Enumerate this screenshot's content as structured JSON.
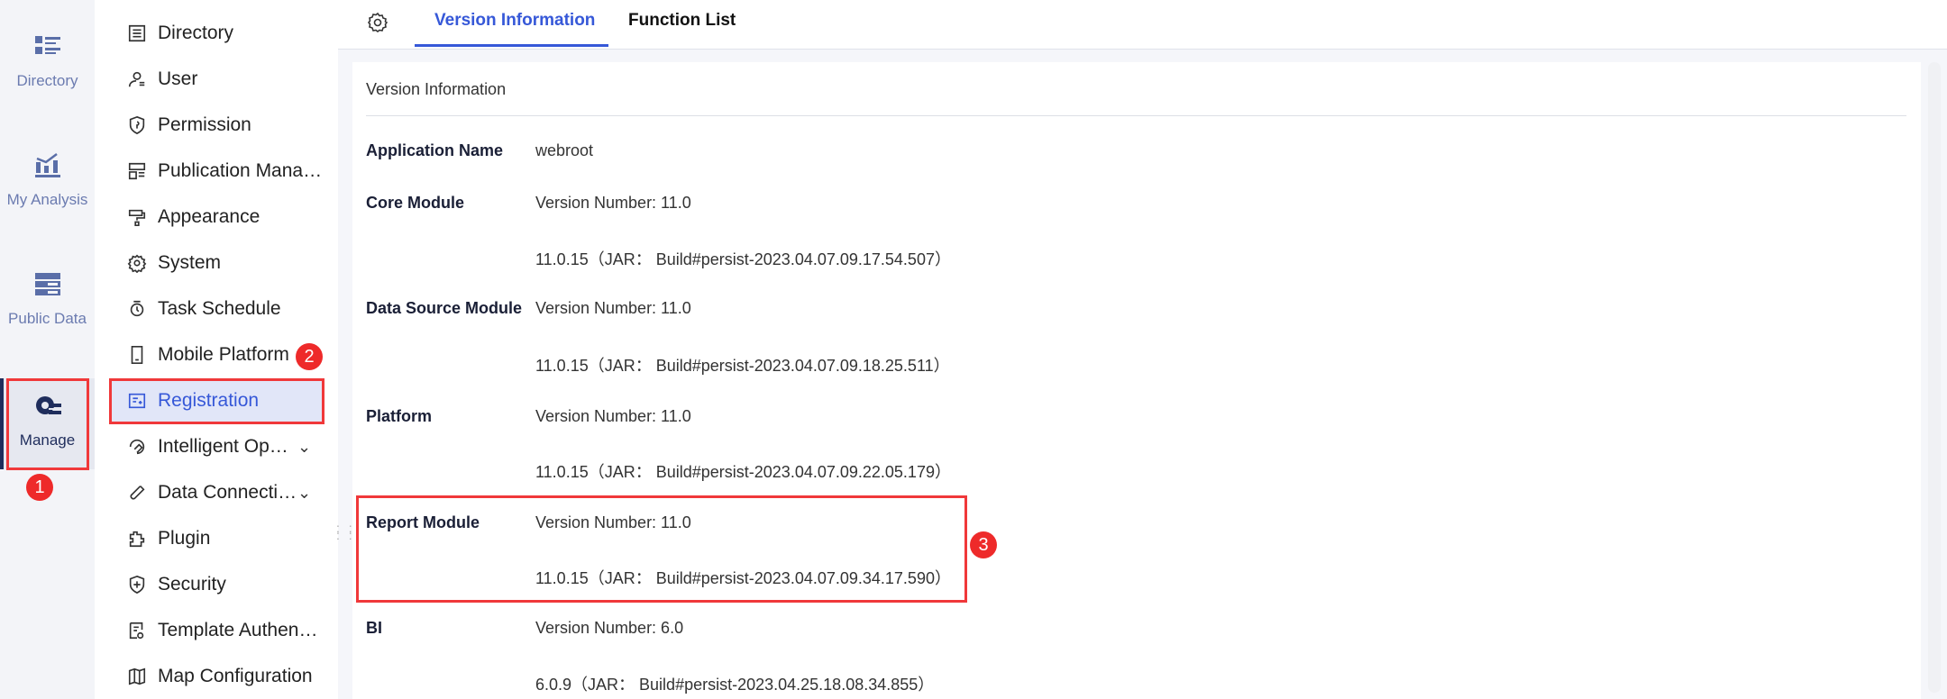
{
  "rail": [
    {
      "label": "Directory",
      "icon": "directory-icon"
    },
    {
      "label": "My Analysis",
      "icon": "analysis-icon"
    },
    {
      "label": "Public Data",
      "icon": "public-data-icon"
    },
    {
      "label": "Manage",
      "icon": "manage-icon",
      "active": true
    }
  ],
  "nav": [
    {
      "label": "Directory"
    },
    {
      "label": "User"
    },
    {
      "label": "Permission"
    },
    {
      "label": "Publication Management"
    },
    {
      "label": "Appearance"
    },
    {
      "label": "System"
    },
    {
      "label": "Task Schedule"
    },
    {
      "label": "Mobile Platform"
    },
    {
      "label": "Registration",
      "active": true
    },
    {
      "label": "Intelligent Operation"
    },
    {
      "label": "Data Connection"
    },
    {
      "label": "Plugin"
    },
    {
      "label": "Security"
    },
    {
      "label": "Template Authentication"
    },
    {
      "label": "Map Configuration"
    }
  ],
  "tabs": {
    "version": "Version Information",
    "functions": "Function List"
  },
  "card": {
    "title": "Version Information",
    "rows": [
      {
        "label": "Application Name",
        "value": "webroot"
      },
      {
        "label": "Core Module",
        "value": "Version Number: 11.0"
      },
      {
        "label": "",
        "value": "11.0.15（JAR： Build#persist-2023.04.07.09.17.54.507）"
      },
      {
        "label": "Data Source Module",
        "value": "Version Number: 11.0"
      },
      {
        "label": "",
        "value": "11.0.15（JAR： Build#persist-2023.04.07.09.18.25.511）"
      },
      {
        "label": "Platform",
        "value": "Version Number: 11.0"
      },
      {
        "label": "",
        "value": "11.0.15（JAR： Build#persist-2023.04.07.09.22.05.179）"
      },
      {
        "label": "Report Module",
        "value": "Version Number: 11.0"
      },
      {
        "label": "",
        "value": "11.0.15（JAR： Build#persist-2023.04.07.09.34.17.590）"
      },
      {
        "label": "BI",
        "value": "Version Number: 6.0"
      },
      {
        "label": "",
        "value": "6.0.9（JAR： Build#persist-2023.04.25.18.08.34.855）"
      }
    ]
  },
  "badges": [
    "1",
    "2",
    "3"
  ],
  "colors": {
    "accent": "#3658d8",
    "annotation": "#ee2a2a",
    "rail_active": "#1f2d5c"
  }
}
